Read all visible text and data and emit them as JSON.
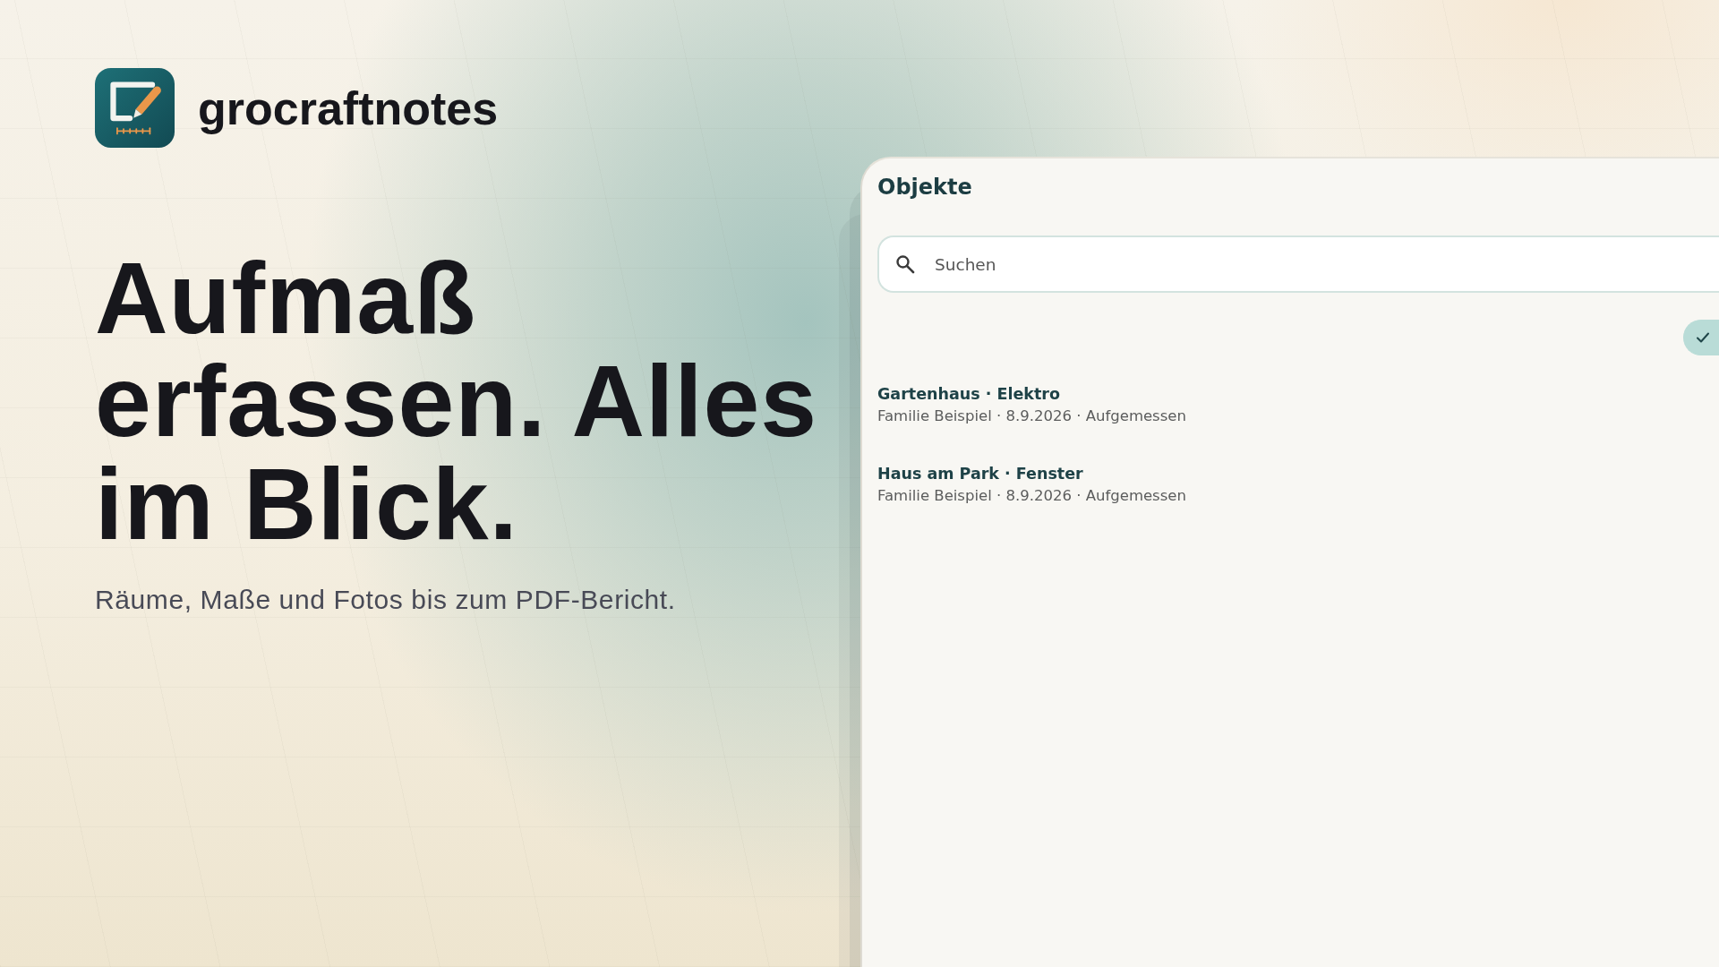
{
  "brand": {
    "name": "grocraftnotes"
  },
  "hero": {
    "headline": "Aufmaß erfassen. Alles im Blick.",
    "subtitle": "Räume, Maße und Fotos bis zum PDF-Bericht."
  },
  "app": {
    "title": "Objekte",
    "search": {
      "placeholder": "Suchen"
    },
    "filter_chip": {
      "selected": true
    },
    "items": [
      {
        "title": "Gartenhaus · Elektro",
        "subtitle": "Familie Beispiel · 8.9.2026 · Aufgemessen",
        "selected": false
      },
      {
        "title": "Haus am Park · Fenster",
        "subtitle": "Familie Beispiel · 8.9.2026 · Aufgemessen",
        "selected": false
      }
    ]
  }
}
